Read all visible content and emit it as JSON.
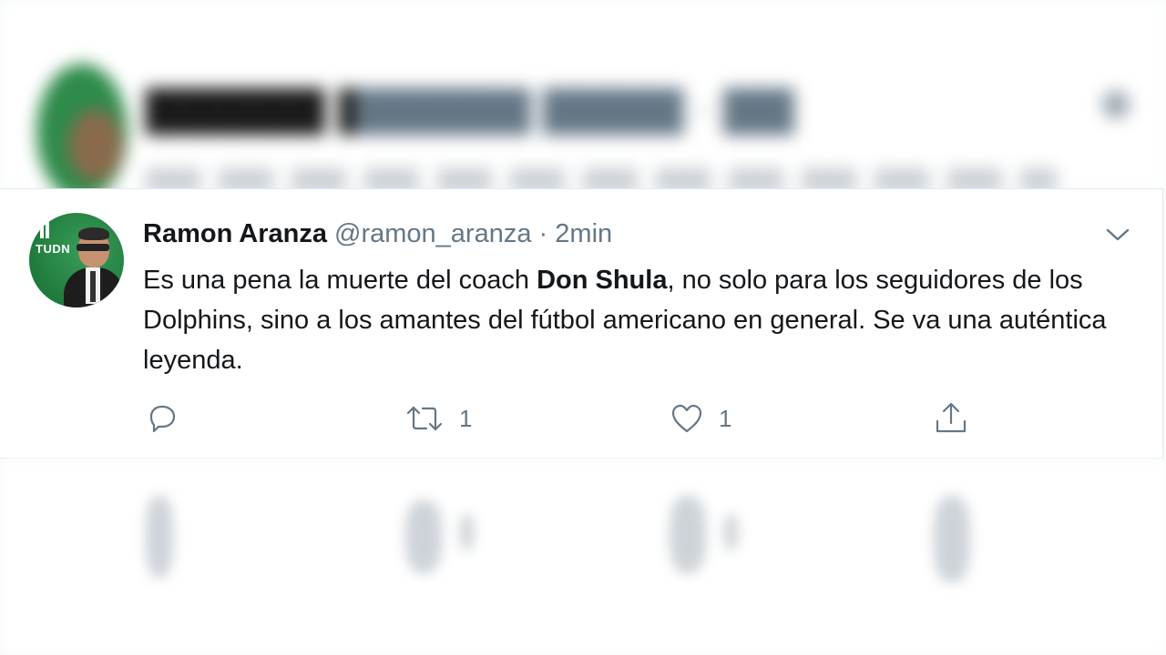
{
  "tweet": {
    "author_name": "Ramon Aranza",
    "handle": "@ramon_aranza",
    "separator": "·",
    "time": "2min",
    "text_part1": "Es una pena la muerte del coach ",
    "text_bold": "Don Shula",
    "text_part2": ", no solo para los seguidores de los Dolphins, sino a los amantes del fútbol americano en general. Se va una auténtica leyenda.",
    "avatar_logo": "TUDN",
    "retweet_count": "1",
    "like_count": "1"
  },
  "icons": {
    "reply": "reply-icon",
    "retweet": "retweet-icon",
    "like": "heart-icon",
    "share": "share-icon",
    "menu": "chevron-down-icon"
  },
  "colors": {
    "text_primary": "#14171a",
    "text_secondary": "#657786",
    "avatar_green": "#1f7a3c",
    "border": "#e1e8ed"
  }
}
